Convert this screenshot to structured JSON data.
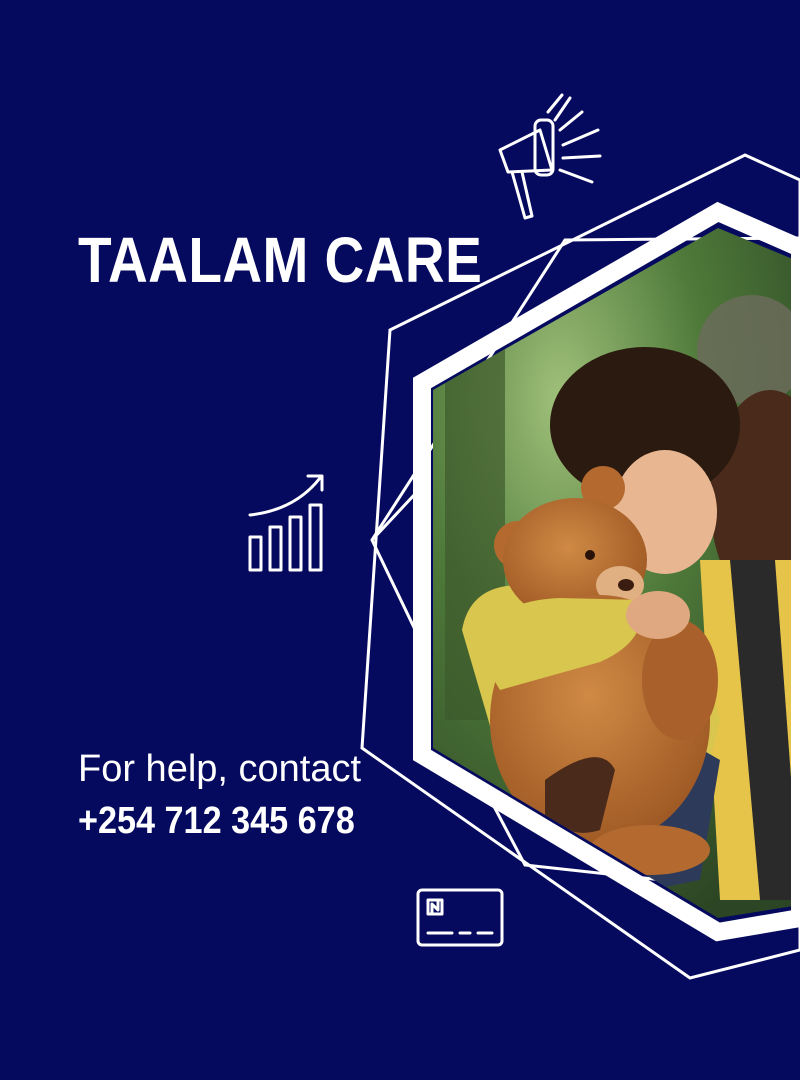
{
  "brand": {
    "title": "TAALAM CARE"
  },
  "contact": {
    "prompt": "For help, contact",
    "phone": "+254 712 345 678"
  },
  "icons": {
    "top": "megaphone-icon",
    "middle": "growth-chart-icon",
    "bottom": "card-icon"
  },
  "photo": {
    "subject": "child-with-teddy-bear-and-father-photo"
  },
  "colors": {
    "background": "#060a5e",
    "foreground": "#ffffff"
  }
}
